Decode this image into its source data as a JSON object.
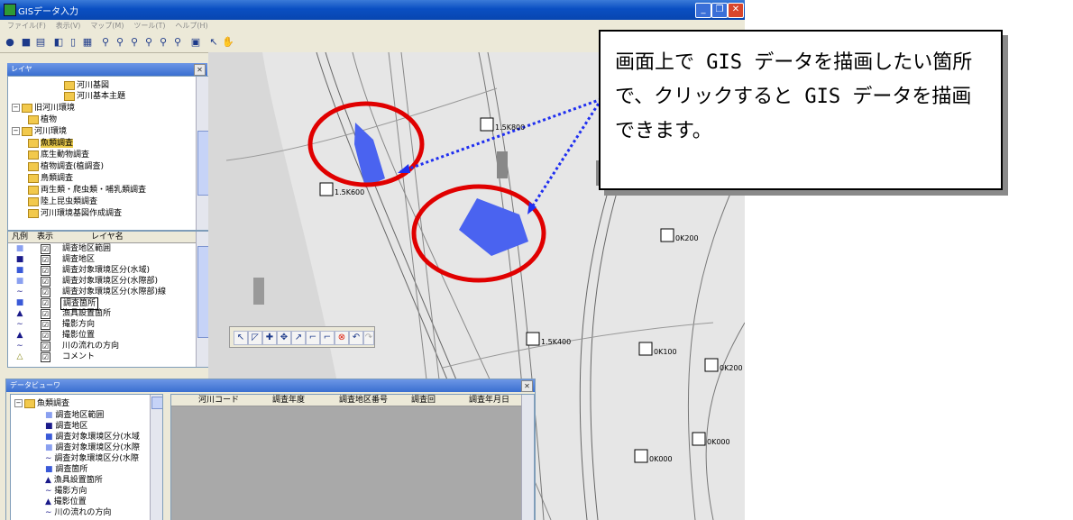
{
  "window": {
    "title": "GISデータ入力",
    "menu": [
      "ファイル(F)",
      "表示(V)",
      "マップ(M)",
      "ツール(T)",
      "ヘルプ(H)"
    ]
  },
  "layer_panel": {
    "title": "レイヤ",
    "tree": [
      {
        "label": "河川基図",
        "level": 3
      },
      {
        "label": "河川基本主題",
        "level": 3
      },
      {
        "label": "旧河川環境",
        "level": 1
      },
      {
        "label": "植物",
        "level": 2
      },
      {
        "label": "河川環境",
        "level": 1
      },
      {
        "label": "魚類調査",
        "level": 2,
        "selected": true
      },
      {
        "label": "底生動物調査",
        "level": 2
      },
      {
        "label": "植物調査(植調査)",
        "level": 2
      },
      {
        "label": "鳥類調査",
        "level": 2
      },
      {
        "label": "両生類・爬虫類・哺乳類調査",
        "level": 2
      },
      {
        "label": "陸上昆虫類調査",
        "level": 2
      },
      {
        "label": "河川環境基図作成調査",
        "level": 2
      }
    ],
    "table": {
      "headers": [
        "凡例",
        "表示",
        "レイヤ名"
      ],
      "rows": [
        {
          "symbol": "square-light",
          "name": "調査地区範囲"
        },
        {
          "symbol": "square-dark",
          "name": "調査地区"
        },
        {
          "symbol": "square-mid",
          "name": "調査対象環境区分(水域)"
        },
        {
          "symbol": "square-light",
          "name": "調査対象環境区分(水際部)"
        },
        {
          "symbol": "line",
          "name": "調査対象環境区分(水際部)線"
        },
        {
          "symbol": "square-mid",
          "name": "調査箇所",
          "selected": true
        },
        {
          "symbol": "triangle",
          "name": "漁具設置箇所"
        },
        {
          "symbol": "line",
          "name": "撮影方向"
        },
        {
          "symbol": "triangle",
          "name": "撮影位置"
        },
        {
          "symbol": "line",
          "name": "川の流れの方向"
        },
        {
          "symbol": "triangle-outline",
          "name": "コメント"
        }
      ],
      "check": "☑"
    }
  },
  "data_viewer": {
    "title": "データビューワ",
    "tree_root": "魚類調査",
    "tree": [
      "調査地区範囲",
      "調査地区",
      "調査対象環境区分(水域",
      "調査対象環境区分(水際",
      "調査対象環境区分(水際",
      "調査箇所",
      "漁具設置箇所",
      "撮影方向",
      "撮影位置",
      "川の流れの方向"
    ],
    "columns": [
      "河川コード",
      "調査年度",
      "調査地区番号",
      "調査回",
      "調査年月日"
    ]
  },
  "map": {
    "labels": [
      {
        "text": "1.5K800"
      },
      {
        "text": "1.5K600"
      },
      {
        "text": "1.5K400"
      },
      {
        "text": "0K200"
      },
      {
        "text": "0K100"
      },
      {
        "text": "0K200"
      },
      {
        "text": "0K000"
      },
      {
        "text": "0K000"
      }
    ],
    "polygon_color": "#4a63f0",
    "circle_color": "#e00000"
  },
  "callout": {
    "text": "画面上で GIS データを描画したい箇所\nで、クリックすると GIS データを描画\nできます。"
  },
  "colors": {
    "titlebar": "#0a4fc2",
    "accent": "#4a63f0",
    "highlight": "#e00000"
  }
}
